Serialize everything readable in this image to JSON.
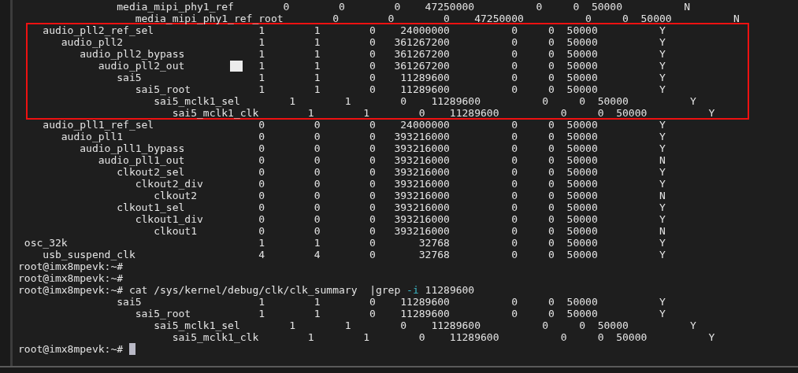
{
  "terminal": {
    "lines": [
      {
        "kind": "output",
        "text": "                media_mipi_phy1_ref        0        0        0    47250000          0     0  50000          N"
      },
      {
        "kind": "output",
        "text": "                   media_mipi_phy1_ref_root        0        0        0    47250000          0     0  50000          N"
      },
      {
        "kind": "output",
        "text": "    audio_pll2_ref_sel                 1        1        0    24000000          0     0  50000          Y"
      },
      {
        "kind": "output",
        "text": "       audio_pll2                      1        1        0   361267200          0     0  50000          Y"
      },
      {
        "kind": "output",
        "text": "          audio_pll2_bypass            1        1        0   361267200          0     0  50000          Y"
      },
      {
        "kind": "output",
        "text": "             audio_pll2_out            1        1        0   361267200          0     0  50000          Y",
        "block_mark": true
      },
      {
        "kind": "output",
        "text": "                sai5                   1        1        0    11289600          0     0  50000          Y"
      },
      {
        "kind": "output",
        "text": "                   sai5_root           1        1        0    11289600          0     0  50000          Y"
      },
      {
        "kind": "output",
        "text": "                      sai5_mclk1_sel        1        1        0    11289600          0     0  50000          Y"
      },
      {
        "kind": "output",
        "text": "                         sai5_mclk1_clk        1        1        0    11289600          0     0  50000          Y"
      },
      {
        "kind": "output",
        "text": "    audio_pll1_ref_sel                 0        0        0    24000000          0     0  50000          Y"
      },
      {
        "kind": "output",
        "text": "       audio_pll1                      0        0        0   393216000          0     0  50000          Y"
      },
      {
        "kind": "output",
        "text": "          audio_pll1_bypass            0        0        0   393216000          0     0  50000          Y"
      },
      {
        "kind": "output",
        "text": "             audio_pll1_out            0        0        0   393216000          0     0  50000          N"
      },
      {
        "kind": "output",
        "text": "                clkout2_sel            0        0        0   393216000          0     0  50000          Y"
      },
      {
        "kind": "output",
        "text": "                   clkout2_div         0        0        0   393216000          0     0  50000          Y"
      },
      {
        "kind": "output",
        "text": "                      clkout2          0        0        0   393216000          0     0  50000          N"
      },
      {
        "kind": "output",
        "text": "                clkout1_sel            0        0        0   393216000          0     0  50000          Y"
      },
      {
        "kind": "output",
        "text": "                   clkout1_div         0        0        0   393216000          0     0  50000          Y"
      },
      {
        "kind": "output",
        "text": "                      clkout1          0        0        0   393216000          0     0  50000          N"
      },
      {
        "kind": "output",
        "text": " osc_32k                               1        1        0       32768          0     0  50000          Y"
      },
      {
        "kind": "output",
        "text": "    usb_suspend_clk                    4        4        0       32768          0     0  50000          Y"
      },
      {
        "kind": "prompt",
        "prompt": "root@imx8mpevk:~#",
        "cursor": false
      },
      {
        "kind": "prompt",
        "prompt": "root@imx8mpevk:~#",
        "cursor": false
      },
      {
        "kind": "command",
        "prompt": "root@imx8mpevk:~#",
        "parts": [
          {
            "text": "cat /sys/kernel/debug/clk/clk_summary  |grep ",
            "highlight": false
          },
          {
            "text": "-i",
            "highlight": true
          },
          {
            "text": " 11289600",
            "highlight": false
          }
        ]
      },
      {
        "kind": "output",
        "text": "                sai5                   1        1        0    11289600          0     0  50000          Y"
      },
      {
        "kind": "output",
        "text": "                   sai5_root           1        1        0    11289600          0     0  50000          Y"
      },
      {
        "kind": "output",
        "text": "                      sai5_mclk1_sel        1        1        0    11289600          0     0  50000          Y"
      },
      {
        "kind": "output",
        "text": "                         sai5_mclk1_clk        1        1        0    11289600          0     0  50000          Y"
      },
      {
        "kind": "prompt",
        "prompt": "root@imx8mpevk:~#",
        "cursor": true
      }
    ]
  }
}
